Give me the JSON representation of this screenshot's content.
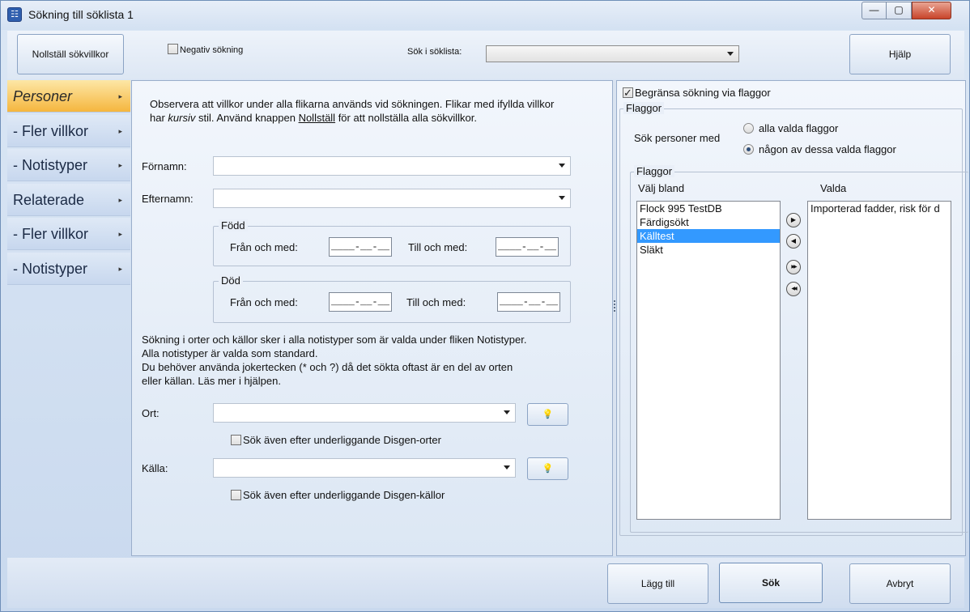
{
  "window": {
    "title": "Sökning till söklista 1",
    "app_icon_glyph": "☷",
    "minimize_glyph": "—",
    "maximize_glyph": "▢",
    "close_glyph": "✕"
  },
  "toolbar": {
    "reset_label": "Nollställ sökvillkor",
    "negative_search_label": "Negativ sökning",
    "search_in_list_label": "Sök i söklista:",
    "search_in_list_value": "",
    "help_label": "Hjälp"
  },
  "nav": {
    "items": [
      {
        "label": "Personer",
        "chevron": "▸"
      },
      {
        "label": "- Fler villkor",
        "chevron": "▸"
      },
      {
        "label": "- Notistyper",
        "chevron": "▸"
      },
      {
        "label": "Relaterade",
        "chevron": "▸"
      },
      {
        "label": "- Fler villkor",
        "chevron": "▸"
      },
      {
        "label": "- Notistyper",
        "chevron": "▸"
      }
    ]
  },
  "center": {
    "info_part1": "Observera att villkor under alla flikarna används vid sökningen. Flikar med ifyllda villkor har ",
    "info_italic": "kursiv",
    "info_part2": " stil. Använd knappen ",
    "info_underline": "Nollställ",
    "info_part3": " för att nollställa alla sökvillkor.",
    "firstname_label": "Förnamn:",
    "firstname_value": "",
    "lastname_label": "Efternamn:",
    "lastname_value": "",
    "born_group": "Född",
    "born_from_label": "Från och med:",
    "born_from_value": "____-__-__",
    "born_to_label": "Till och med:",
    "born_to_value": "____-__-__",
    "dead_group": "Död",
    "dead_from_label": "Från och med:",
    "dead_from_value": "____-__-__",
    "dead_to_label": "Till och med:",
    "dead_to_value": "____-__-__",
    "places_info_line1": "Sökning i orter och källor sker i alla notistyper som är valda under fliken Notistyper.",
    "places_info_line2": "Alla notistyper är valda som standard.",
    "places_info_line3": "Du behöver använda jokertecken (* och ?) då det sökta oftast är en del av orten",
    "places_info_line4": "eller källan. Läs mer i hjälpen.",
    "place_label": "Ort:",
    "place_value": "",
    "place_sub_label": "Sök även efter underliggande Disgen-orter",
    "source_label": "Källa:",
    "source_value": "",
    "source_sub_label": "Sök även efter underliggande Disgen-källor",
    "bulb_glyph": "💡"
  },
  "right": {
    "limit_flags_label": "Begränsa sökning via flaggor",
    "flags_group": "Flaggor",
    "search_persons_with": "Sök personer med",
    "radio_all": "alla valda flaggor",
    "radio_any": "någon av dessa valda flaggor",
    "inner_flags_group": "Flaggor",
    "choose_from_label": "Välj bland",
    "selected_label": "Valda",
    "available": [
      "Flock 995 TestDB",
      "Färdigsökt",
      "Källtest",
      "Släkt"
    ],
    "selected_index": 2,
    "chosen": [
      "Importerad fadder, risk för d"
    ],
    "move_right_glyph": "▶",
    "move_left_glyph": "◀",
    "move_all_right_glyph": "▶▶",
    "move_all_left_glyph": "◀◀"
  },
  "bottom": {
    "add_label": "Lägg till",
    "search_label": "Sök",
    "cancel_label": "Avbryt"
  }
}
